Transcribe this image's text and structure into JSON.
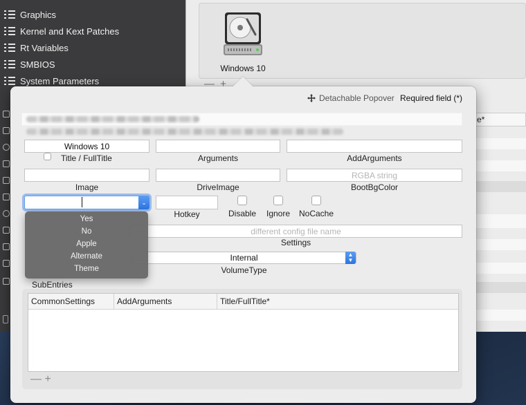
{
  "sidebar": {
    "items": [
      {
        "label": "Graphics"
      },
      {
        "label": "Kernel and Kext Patches"
      },
      {
        "label": "Rt Variables"
      },
      {
        "label": "SMBIOS"
      },
      {
        "label": "System Parameters"
      }
    ]
  },
  "background": {
    "entry_title": "Windows 10",
    "plus_minus": "— +",
    "right_field_text": "e*"
  },
  "popover": {
    "detach_label": "Detachable Popover",
    "required_label": "Required field (*)",
    "title_value": "Windows 10",
    "title_label": "Title / FullTitle",
    "arguments_label": "Arguments",
    "addarguments_label": "AddArguments",
    "image_label": "Image",
    "driveimage_label": "DriveImage",
    "bootbgcolor_label": "BootBgColor",
    "bootbgcolor_placeholder": "RGBA string",
    "hotkey_label": "Hotkey",
    "disable_label": "Disable",
    "ignore_label": "Ignore",
    "nocache_label": "NoCache",
    "settings_label": "Settings",
    "settings_placeholder": "different config file name",
    "volumetype_value": "Internal",
    "volumetype_label": "VolumeType",
    "subentries_label": "SubEntries",
    "subentries_columns": [
      "CommonSettings",
      "AddArguments",
      "Title/FullTitle*"
    ],
    "subentries_plus_minus": "— +"
  },
  "combo_menu": {
    "options": [
      "Yes",
      "No",
      "Apple",
      "Alternate",
      "Theme"
    ]
  },
  "colors": {
    "accent": "#3b82e6",
    "sidebar_bg": "#3b3b3d",
    "popover_bg": "#ececec",
    "menu_bg": "#686868"
  }
}
